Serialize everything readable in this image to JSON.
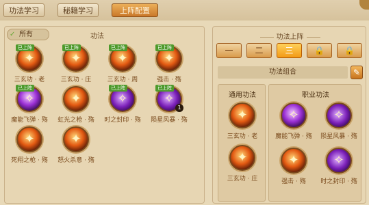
{
  "tabs": [
    {
      "label": "功法学习",
      "active": false
    },
    {
      "label": "秘籍学习",
      "active": false
    },
    {
      "label": "上阵配置",
      "active": true
    }
  ],
  "left": {
    "filter_label": "所有",
    "section_title": "功法",
    "skills": [
      {
        "label": "三玄功 · 老",
        "badge": "已上阵",
        "style": "fire",
        "icon": "fire-fist-icon"
      },
      {
        "label": "三玄功 · 庄",
        "badge": "已上阵",
        "style": "fire",
        "icon": "fire-figure-icon"
      },
      {
        "label": "三玄功 · 周",
        "badge": "已上阵",
        "style": "fire",
        "icon": "fire-monk-icon"
      },
      {
        "label": "强击 · 殇",
        "badge": "已上阵",
        "style": "fire",
        "icon": "strike-icon"
      },
      {
        "label": "魔能飞弹 · 殇",
        "badge": "已上阵",
        "style": "purple",
        "icon": "magic-missile-icon"
      },
      {
        "label": "虹光之枪 · 殇",
        "badge": "",
        "style": "fire",
        "icon": "light-spear-icon"
      },
      {
        "label": "时之封印 · 殇",
        "badge": "已上阵",
        "style": "violet",
        "icon": "time-seal-icon"
      },
      {
        "label": "陨星风暴 · 殇",
        "badge": "已上阵",
        "style": "violet",
        "icon": "meteor-storm-icon",
        "rank": "1"
      },
      {
        "label": "死翔之枪 · 殇",
        "badge": "",
        "style": "fire",
        "icon": "death-spear-icon"
      },
      {
        "label": "怒火杀意 · 殇",
        "badge": "",
        "style": "fire",
        "icon": "rage-icon"
      }
    ]
  },
  "right": {
    "section_title": "功法上阵",
    "slots": [
      {
        "label": "一",
        "active": false,
        "locked": false
      },
      {
        "label": "二",
        "active": false,
        "locked": false
      },
      {
        "label": "三",
        "active": true,
        "locked": false
      },
      {
        "label": "🔒",
        "active": false,
        "locked": true
      },
      {
        "label": "🔒",
        "active": false,
        "locked": true
      }
    ],
    "combo_label": "功法组合",
    "common_title": "通用功法",
    "class_title": "职业功法",
    "common_skills": [
      {
        "label": "三玄功 · 老",
        "style": "fire",
        "icon": "fire-fist-icon"
      },
      {
        "label": "三玄功 · 庄",
        "style": "fire",
        "icon": "fire-figure-icon"
      }
    ],
    "class_skills": [
      {
        "label": "魔能飞弹 · 殇",
        "style": "purple",
        "icon": "magic-missile-icon"
      },
      {
        "label": "陨星风暴 · 殇",
        "style": "violet",
        "icon": "meteor-storm-icon"
      },
      {
        "label": "强击 · 殇",
        "style": "fire",
        "icon": "strike-icon"
      },
      {
        "label": "时之封印 · 殇",
        "style": "violet",
        "icon": "time-seal-icon"
      }
    ]
  }
}
